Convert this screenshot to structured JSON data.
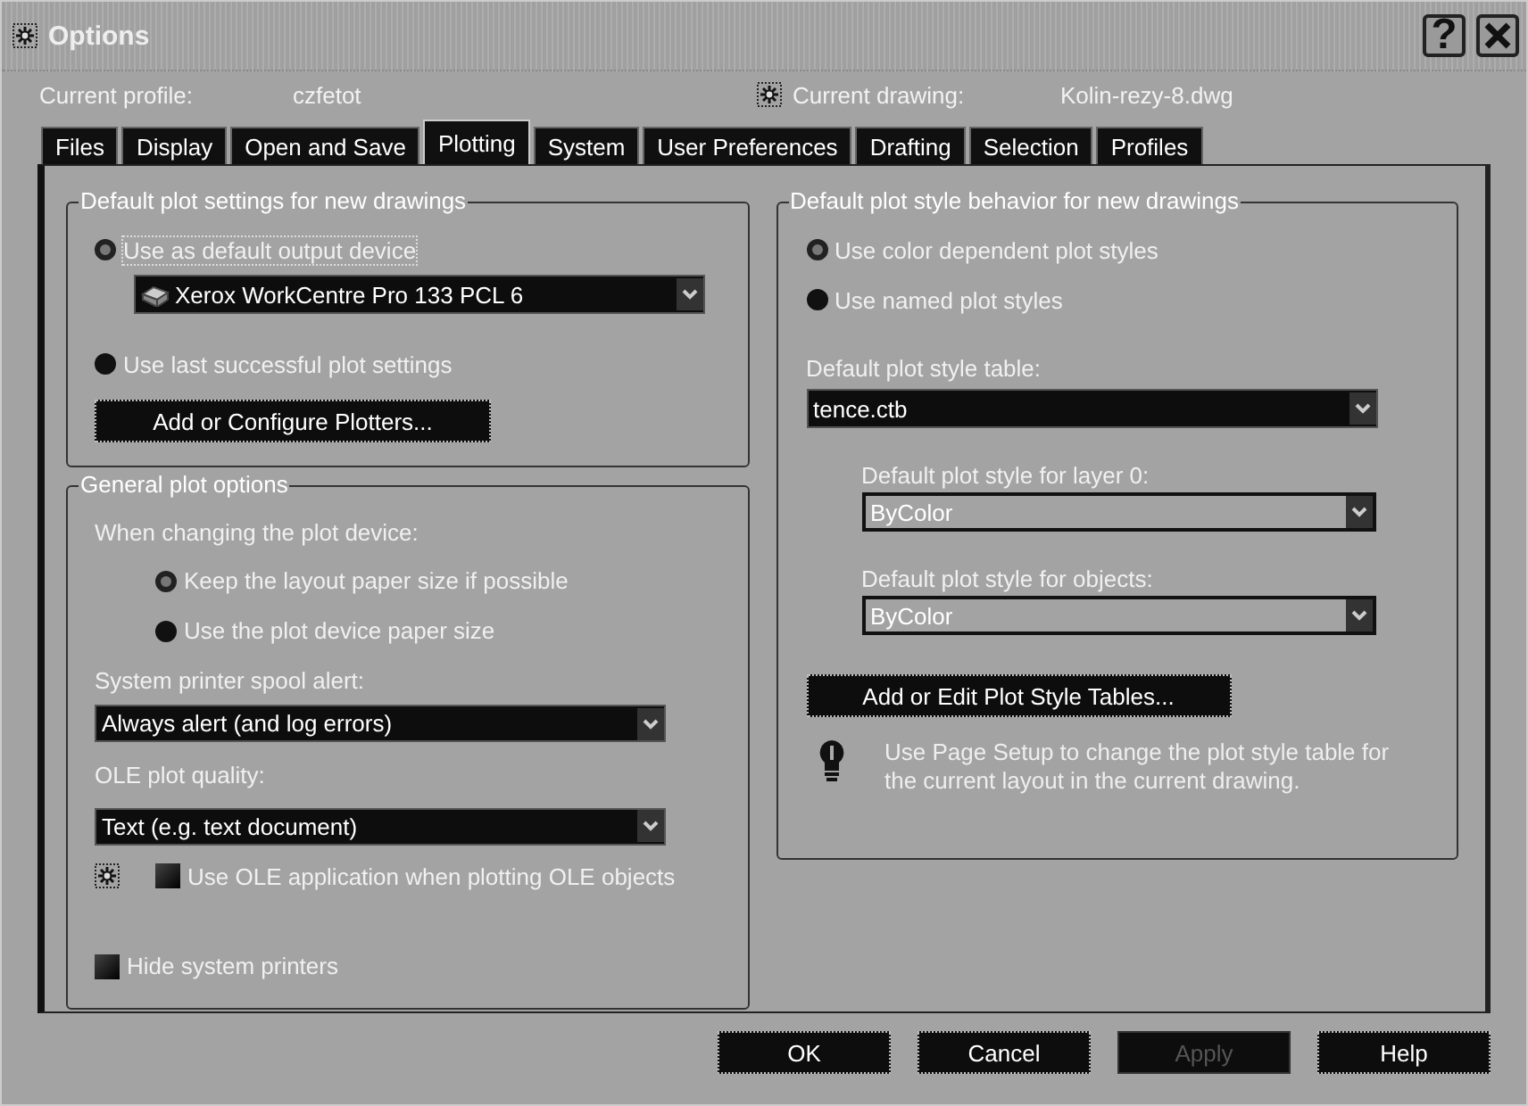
{
  "window": {
    "title": "Options",
    "help_glyph": "?"
  },
  "profile": {
    "label": "Current profile:",
    "value": "czfetot"
  },
  "drawing": {
    "label": "Current drawing:",
    "value": "Kolin-rezy-8.dwg"
  },
  "tabs": [
    {
      "label": "Files",
      "selected": false
    },
    {
      "label": "Display",
      "selected": false
    },
    {
      "label": "Open and Save",
      "selected": false
    },
    {
      "label": "Plotting",
      "selected": true
    },
    {
      "label": "System",
      "selected": false
    },
    {
      "label": "User Preferences",
      "selected": false
    },
    {
      "label": "Drafting",
      "selected": false
    },
    {
      "label": "Selection",
      "selected": false
    },
    {
      "label": "Profiles",
      "selected": false
    }
  ],
  "default_plot_settings": {
    "title": "Default plot settings for new drawings",
    "radios": [
      {
        "label": "Use as default output device",
        "selected": true
      },
      {
        "label": "Use last successful plot settings",
        "selected": false
      }
    ],
    "device": {
      "value": "Xerox WorkCentre Pro 133 PCL 6"
    },
    "button": "Add or Configure Plotters..."
  },
  "general_plot_options": {
    "title": "General plot options",
    "device_change_label": "When changing the plot device:",
    "radios": [
      {
        "label": "Keep the layout paper size if possible",
        "selected": true
      },
      {
        "label": "Use the plot device paper size",
        "selected": false
      }
    ],
    "spool_alert": {
      "label": "System printer spool alert:",
      "value": "Always alert (and log errors)"
    },
    "ole_quality": {
      "label": "OLE plot quality:",
      "value": "Text (e.g. text document)"
    },
    "checkboxes": [
      {
        "label": "Use OLE application when plotting OLE objects",
        "checked": false
      },
      {
        "label": "Hide system printers",
        "checked": false
      }
    ]
  },
  "plot_style_behavior": {
    "title": "Default plot style behavior for new drawings",
    "radios": [
      {
        "label": "Use color dependent plot styles",
        "selected": true
      },
      {
        "label": "Use named plot styles",
        "selected": false
      }
    ],
    "style_table": {
      "label": "Default plot style table:",
      "value": "tence.ctb",
      "disabled": false
    },
    "layer0": {
      "label": "Default plot style for layer 0:",
      "value": "ByColor",
      "disabled": true
    },
    "objects": {
      "label": "Default plot style for objects:",
      "value": "ByColor",
      "disabled": true
    },
    "button": "Add or Edit Plot Style Tables...",
    "note": "Use Page Setup to change the plot style table for the current layout in the current drawing."
  },
  "buttons": [
    {
      "label": "OK",
      "disabled": false
    },
    {
      "label": "Cancel",
      "disabled": false
    },
    {
      "label": "Apply",
      "disabled": true
    },
    {
      "label": "Help",
      "disabled": false
    }
  ]
}
